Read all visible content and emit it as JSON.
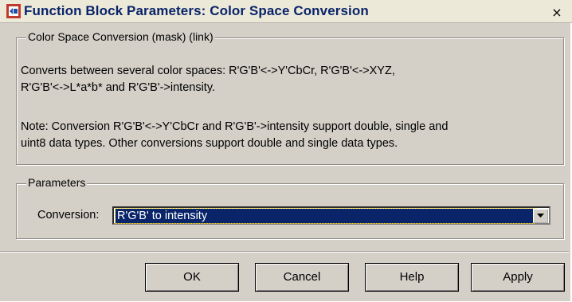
{
  "window": {
    "title": "Function Block Parameters: Color Space  Conversion",
    "close_label": "×"
  },
  "mask_group": {
    "title": "Color Space Conversion (mask) (link)",
    "description": "Converts between several color spaces: R'G'B'<->Y'CbCr, R'G'B'<->XYZ,\nR'G'B'<->L*a*b* and R'G'B'->intensity.",
    "note": "Note:  Conversion R'G'B'<->Y'CbCr and R'G'B'->intensity support double, single and\nuint8 data types.  Other conversions support double and single data types."
  },
  "parameters_group": {
    "title": "Parameters",
    "conversion_label": "Conversion:",
    "conversion_value": "R'G'B' to intensity"
  },
  "buttons": {
    "ok": "OK",
    "cancel": "Cancel",
    "help": "Help",
    "apply": "Apply"
  },
  "colors": {
    "title_text": "#0a246a",
    "dialog_bg": "#d4d0c8",
    "selection_bg": "#0a246a"
  }
}
